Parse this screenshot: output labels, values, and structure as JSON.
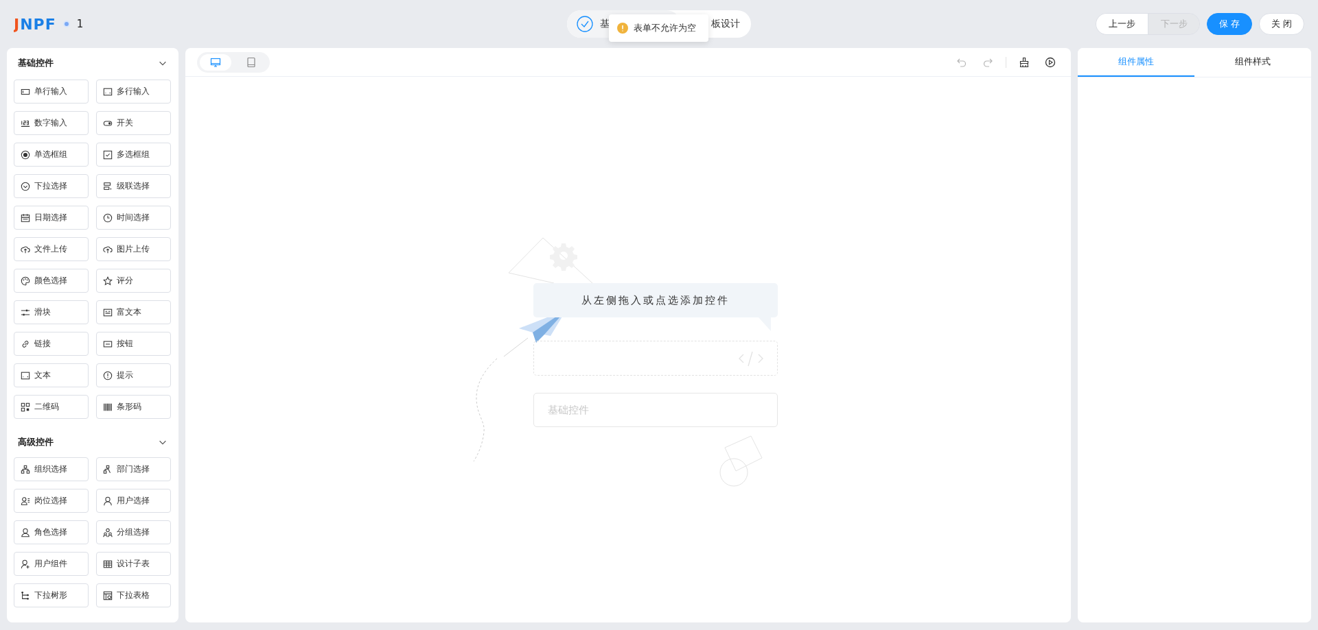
{
  "header": {
    "logo": "JNPF",
    "app_name": "1"
  },
  "steps": [
    {
      "label": "基",
      "done": true
    },
    {
      "label": "板设计",
      "done": false
    }
  ],
  "toast": {
    "kind": "warning",
    "message": "表单不允许为空"
  },
  "step_buttons": [
    {
      "label": "上一步",
      "disabled": false
    },
    {
      "label": "下一步",
      "disabled": true
    }
  ],
  "save_button": "保 存",
  "close_button": "关 闭",
  "sidebar": {
    "sections": [
      {
        "title": "基础控件",
        "expanded": true,
        "items": [
          "单行输入",
          "多行输入",
          "数字输入",
          "开关",
          "单选框组",
          "多选框组",
          "下拉选择",
          "级联选择",
          "日期选择",
          "时间选择",
          "文件上传",
          "图片上传",
          "颜色选择",
          "评分",
          "滑块",
          "富文本",
          "链接",
          "按钮",
          "文本",
          "提示",
          "二维码",
          "条形码"
        ]
      },
      {
        "title": "高级控件",
        "expanded": true,
        "items": [
          "组织选择",
          "部门选择",
          "岗位选择",
          "用户选择",
          "角色选择",
          "分组选择",
          "用户组件",
          "设计子表",
          "下拉树形",
          "下拉表格"
        ]
      }
    ]
  },
  "canvas": {
    "devices": [
      {
        "kind": "desktop",
        "selected": true
      },
      {
        "kind": "tablet",
        "selected": false
      }
    ],
    "tools": [
      {
        "kind": "undo",
        "disabled": true
      },
      {
        "kind": "redo",
        "disabled": true
      },
      {
        "kind": "clear",
        "disabled": false
      },
      {
        "kind": "preview",
        "disabled": false
      }
    ],
    "empty_hint": "从左侧拖入或点选添加控件",
    "sample_field": {
      "placeholder": "基础控件"
    }
  },
  "properties_panel": {
    "tabs": [
      {
        "label": "组件属性",
        "selected": true
      },
      {
        "label": "组件样式",
        "selected": false
      }
    ]
  }
}
